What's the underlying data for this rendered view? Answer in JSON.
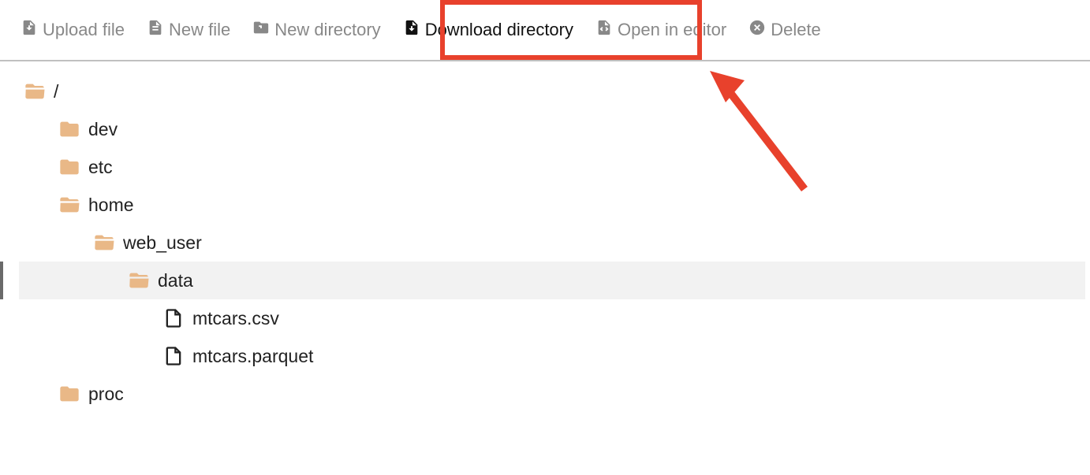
{
  "toolbar": {
    "upload_file": "Upload file",
    "new_file": "New file",
    "new_directory": "New directory",
    "download_directory": "Download directory",
    "open_in_editor": "Open in editor",
    "delete": "Delete"
  },
  "tree": {
    "root": "/",
    "items": [
      {
        "label": "dev"
      },
      {
        "label": "etc"
      },
      {
        "label": "home"
      },
      {
        "label": "web_user"
      },
      {
        "label": "data"
      },
      {
        "label": "mtcars.csv"
      },
      {
        "label": "mtcars.parquet"
      },
      {
        "label": "proc"
      }
    ]
  },
  "annotation": {
    "highlighted_action": "download_directory"
  }
}
